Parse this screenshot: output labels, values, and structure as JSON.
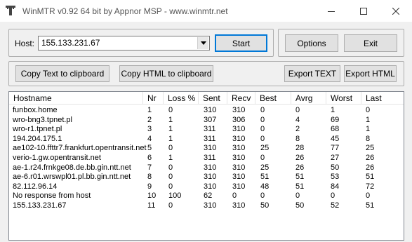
{
  "window": {
    "title": "WinMTR v0.92 64 bit by Appnor MSP - www.winmtr.net"
  },
  "host": {
    "label": "Host:",
    "value": "155.133.231.67"
  },
  "buttons": {
    "start": "Start",
    "options": "Options",
    "exit": "Exit",
    "copy_text": "Copy Text to clipboard",
    "copy_html": "Copy HTML to clipboard",
    "export_text": "Export TEXT",
    "export_html": "Export HTML"
  },
  "table": {
    "columns": [
      "Hostname",
      "Nr",
      "Loss %",
      "Sent",
      "Recv",
      "Best",
      "Avrg",
      "Worst",
      "Last"
    ],
    "rows": [
      [
        "funbox.home",
        "1",
        "0",
        "310",
        "310",
        "0",
        "0",
        "1",
        "0"
      ],
      [
        "wro-bng3.tpnet.pl",
        "2",
        "1",
        "307",
        "306",
        "0",
        "4",
        "69",
        "1"
      ],
      [
        "wro-r1.tpnet.pl",
        "3",
        "1",
        "311",
        "310",
        "0",
        "2",
        "68",
        "1"
      ],
      [
        "194.204.175.1",
        "4",
        "1",
        "311",
        "310",
        "0",
        "8",
        "45",
        "8"
      ],
      [
        "ae102-10.ffttr7.frankfurt.opentransit.net",
        "5",
        "0",
        "310",
        "310",
        "25",
        "28",
        "77",
        "25"
      ],
      [
        "verio-1.gw.opentransit.net",
        "6",
        "1",
        "311",
        "310",
        "0",
        "26",
        "27",
        "26"
      ],
      [
        "ae-1.r24.frnkge08.de.bb.gin.ntt.net",
        "7",
        "0",
        "310",
        "310",
        "25",
        "26",
        "50",
        "26"
      ],
      [
        "ae-6.r01.wrswpl01.pl.bb.gin.ntt.net",
        "8",
        "0",
        "310",
        "310",
        "51",
        "51",
        "53",
        "51"
      ],
      [
        "82.112.96.14",
        "9",
        "0",
        "310",
        "310",
        "48",
        "51",
        "84",
        "72"
      ],
      [
        "No response from host",
        "10",
        "100",
        "62",
        "0",
        "0",
        "0",
        "0",
        "0"
      ],
      [
        "155.133.231.67",
        "11",
        "0",
        "310",
        "310",
        "50",
        "50",
        "52",
        "51"
      ]
    ]
  }
}
